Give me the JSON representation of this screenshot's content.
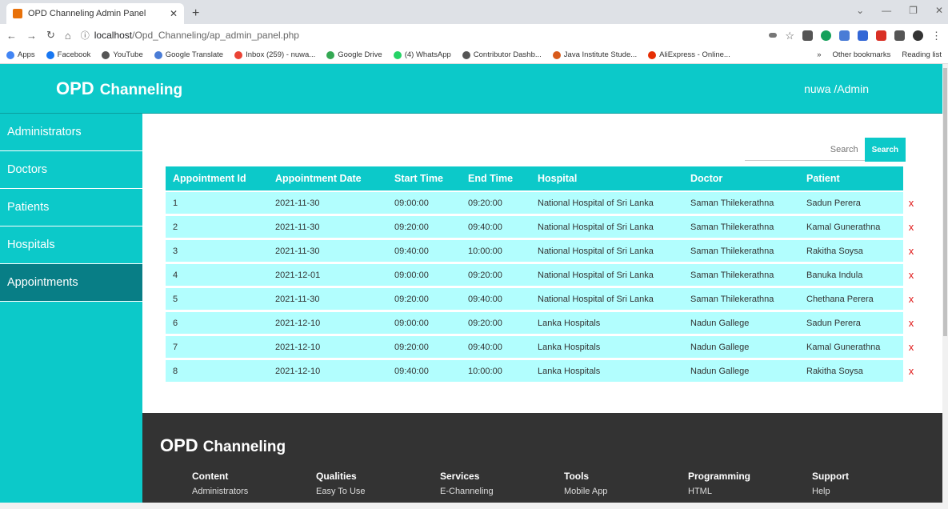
{
  "browser": {
    "tab_title": "OPD Channeling Admin Panel",
    "url_host": "localhost",
    "url_path": "/Opd_Channeling/ap_admin_panel.php",
    "bookmarks": [
      "Apps",
      "Facebook",
      "YouTube",
      "Google Translate",
      "Inbox (259) - nuwa...",
      "Google Drive",
      "(4) WhatsApp",
      "Contributor Dashb...",
      "Java Institute Stude...",
      "AliExpress - Online..."
    ],
    "bookmarks_right": [
      "»",
      "Other bookmarks",
      "Reading list"
    ]
  },
  "header": {
    "brand_big": "OPD",
    "brand_small": "Channeling",
    "user": "nuwa /Admin"
  },
  "sidebar": {
    "items": [
      {
        "label": "Administrators",
        "active": false
      },
      {
        "label": "Doctors",
        "active": false
      },
      {
        "label": "Patients",
        "active": false
      },
      {
        "label": "Hospitals",
        "active": false
      },
      {
        "label": "Appointments",
        "active": true
      }
    ]
  },
  "search": {
    "placeholder": "Search",
    "button_label": "Search"
  },
  "table": {
    "columns": [
      "Appointment Id",
      "Appointment Date",
      "Start Time",
      "End Time",
      "Hospital",
      "Doctor",
      "Patient"
    ],
    "delete_symbol": "x",
    "rows": [
      [
        "1",
        "2021-11-30",
        "09:00:00",
        "09:20:00",
        "National Hospital of Sri Lanka",
        "Saman Thilekerathna",
        "Sadun Perera"
      ],
      [
        "2",
        "2021-11-30",
        "09:20:00",
        "09:40:00",
        "National Hospital of Sri Lanka",
        "Saman Thilekerathna",
        "Kamal Gunerathna"
      ],
      [
        "3",
        "2021-11-30",
        "09:40:00",
        "10:00:00",
        "National Hospital of Sri Lanka",
        "Saman Thilekerathna",
        "Rakitha Soysa"
      ],
      [
        "4",
        "2021-12-01",
        "09:00:00",
        "09:20:00",
        "National Hospital of Sri Lanka",
        "Saman Thilekerathna",
        "Banuka Indula"
      ],
      [
        "5",
        "2021-11-30",
        "09:20:00",
        "09:40:00",
        "National Hospital of Sri Lanka",
        "Saman Thilekerathna",
        "Chethana Perera"
      ],
      [
        "6",
        "2021-12-10",
        "09:00:00",
        "09:20:00",
        "Lanka Hospitals",
        "Nadun Gallege",
        "Sadun Perera"
      ],
      [
        "7",
        "2021-12-10",
        "09:20:00",
        "09:40:00",
        "Lanka Hospitals",
        "Nadun Gallege",
        "Kamal Gunerathna"
      ],
      [
        "8",
        "2021-12-10",
        "09:40:00",
        "10:00:00",
        "Lanka Hospitals",
        "Nadun Gallege",
        "Rakitha Soysa"
      ]
    ]
  },
  "footer": {
    "brand_big": "OPD",
    "brand_small": "Channeling",
    "columns": [
      {
        "heading": "Content",
        "link": "Administrators"
      },
      {
        "heading": "Qualities",
        "link": "Easy To Use"
      },
      {
        "heading": "Services",
        "link": "E-Channeling"
      },
      {
        "heading": "Tools",
        "link": "Mobile App"
      },
      {
        "heading": "Programming",
        "link": "HTML"
      },
      {
        "heading": "Support",
        "link": "Help"
      }
    ]
  },
  "colors": {
    "accent": "#0cc9c9",
    "active_sidebar": "#087e86",
    "row_bg": "#b2fefe",
    "delete": "#e01919",
    "footer_bg": "#333333"
  }
}
